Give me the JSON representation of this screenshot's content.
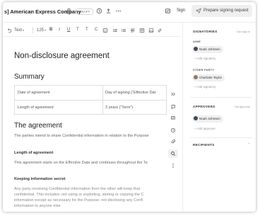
{
  "topbar": {
    "title": "s] American Express Company",
    "badge": "DRAFT",
    "sign_label": "Sign",
    "prepare_label": "Prepare signing request"
  },
  "toolbar": {
    "style_select": "Text",
    "size_select": "125",
    "bold": "B",
    "italic": "I",
    "underline": "U",
    "strike": "T",
    "clear_format": "T",
    "code": "C"
  },
  "document": {
    "title": "Non-disclosure agreement",
    "summary_heading": "Summary",
    "summary_table": [
      [
        "Date of agreement",
        "Day of signing (“Effective Dat"
      ],
      [
        "Length of agreement",
        "3 years (“Term”)"
      ]
    ],
    "agreement_heading": "The agreement",
    "intro_text": "The parties intend to share Confidential information in relation to the Purpose",
    "length_heading": "Length of agreement",
    "length_text": "This agreement starts on the Effective Date and continues throughout the Te",
    "secret_heading": "Keeping information secret",
    "secret_lines": [
      "Any party receiving Confidential information from the other will keep that",
      "confidential. This includes: not using or exploiting, storing or copying the C",
      "information except as necessary for the Purpose; not disclosing any Confi",
      "information to anyone else"
    ]
  },
  "panel": {
    "signatories_title": "SIGNATORIES",
    "signatories_link": "Can sign in",
    "aiwe_label": "AIWE",
    "signatory_1": "Noah Johnsen",
    "add_signatory_1": "+ Add signatory",
    "other_party_label": "OTHER PARTY",
    "signatory_2": "Charlotte Taylor",
    "add_signatory_2": "+ Add signatory",
    "approvers_title": "APPROVERS",
    "approvers_link": "Get approval",
    "approver_1": "Noah Johnsen",
    "add_approver": "+ Add approver",
    "recipients_title": "RECIPIENTS",
    "recipients_chevron": "›"
  },
  "colors": {
    "avatar_noah": "#3d4a5c",
    "avatar_charlotte": "#8a7a6a",
    "panel_chip_bg": "#efefef"
  }
}
